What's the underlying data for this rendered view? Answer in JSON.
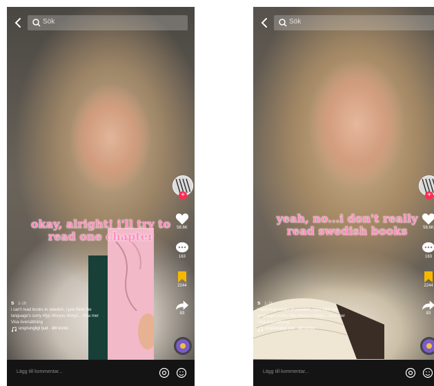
{
  "phones": [
    {
      "search_text": "Sök",
      "caption_line1": "okay, alright! i'll try to",
      "caption_line2": "read one chapter",
      "like_count": "58.6K",
      "comment_count": "163",
      "bookmark_count": "2244",
      "share_count": "83",
      "username": "s",
      "date": "1-16",
      "description_line1": "i can't read books in swedish, i just think the",
      "description_line2": "language's sorry #fyp #foryou #foryo... Visa mer",
      "description_line3": "Visa översättning",
      "sound_text": "ursprungligt ljud - ditt konto",
      "comment_placeholder": "Lägg till kommentar..."
    },
    {
      "search_text": "Sök",
      "caption_line1": "yeah, no...i don't really",
      "caption_line2": "read swedish books",
      "like_count": "58.6K",
      "comment_count": "163",
      "bookmark_count": "2244",
      "share_count": "83",
      "username": "s",
      "date": "1-16",
      "description_line1": "i can't read books in swedish, i just think the",
      "description_line2": "language's sorry #fyp #foryou #foryo... Visa mer",
      "description_line3": "Visa översättning",
      "sound_text": "ursprungligt ljud - ditt konto",
      "comment_placeholder": "Lägg till kommentar..."
    }
  ],
  "colors": {
    "caption": "#ff8fc0",
    "bookmark": "#f5b800",
    "follow_badge": "#fe2c55"
  },
  "icons": [
    "back-icon",
    "search-icon",
    "heart-icon",
    "comment-icon",
    "bookmark-icon",
    "share-icon",
    "music-icon",
    "at-icon",
    "emoji-icon"
  ]
}
